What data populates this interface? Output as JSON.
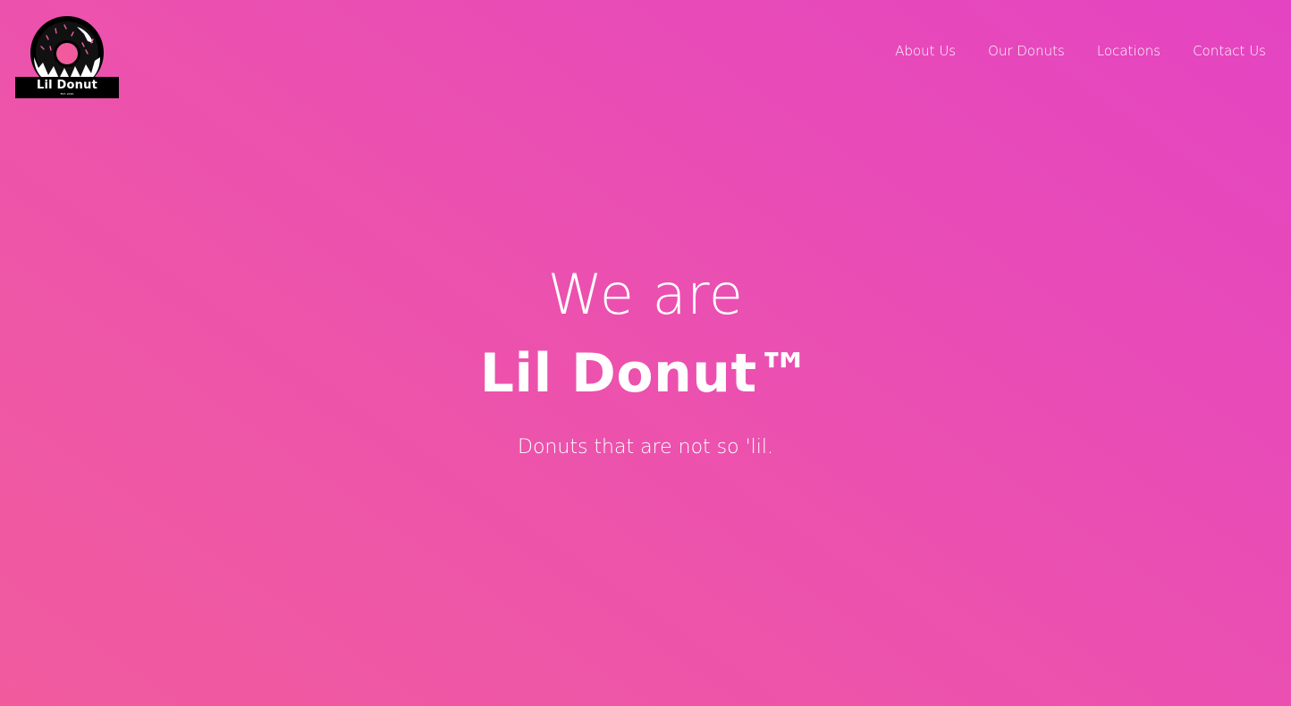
{
  "brand": {
    "logo_name": "Lil Donut",
    "logo_est": "EST. 2020",
    "logo_icon": "donut-icon"
  },
  "nav": {
    "items": [
      {
        "label": "About Us"
      },
      {
        "label": "Our Donuts"
      },
      {
        "label": "Locations"
      },
      {
        "label": "Contact Us"
      }
    ]
  },
  "hero": {
    "line1": "We are",
    "title": "Lil Donut™",
    "tagline": "Donuts that are not so 'lil."
  },
  "colors": {
    "gradient_start": "#f15b9e",
    "gradient_end": "#e444c2",
    "text": "#ffffff",
    "logo_bg": "#000000"
  }
}
